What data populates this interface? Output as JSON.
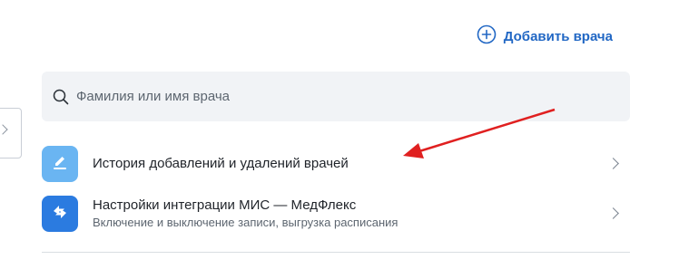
{
  "header": {
    "add_doctor_label": "Добавить врача"
  },
  "search": {
    "placeholder": "Фамилия или имя врача",
    "value": ""
  },
  "menu": {
    "history": {
      "title": "История добавлений и удалений врачей"
    },
    "integration": {
      "title": "Настройки интеграции МИС — МедФлекс",
      "subtitle": "Включение и выключение записи, выгрузка расписания"
    }
  },
  "colors": {
    "accent": "#2167c4",
    "history_tile": "#6ab5f2",
    "integration_tile": "#2b7be0",
    "annotation_arrow": "#e02020"
  },
  "icons": {
    "add": "plus-circle-icon",
    "search": "search-icon",
    "history": "pencil-icon",
    "integration": "arrows-exchange-icon",
    "chevron": "chevron-right-icon"
  }
}
